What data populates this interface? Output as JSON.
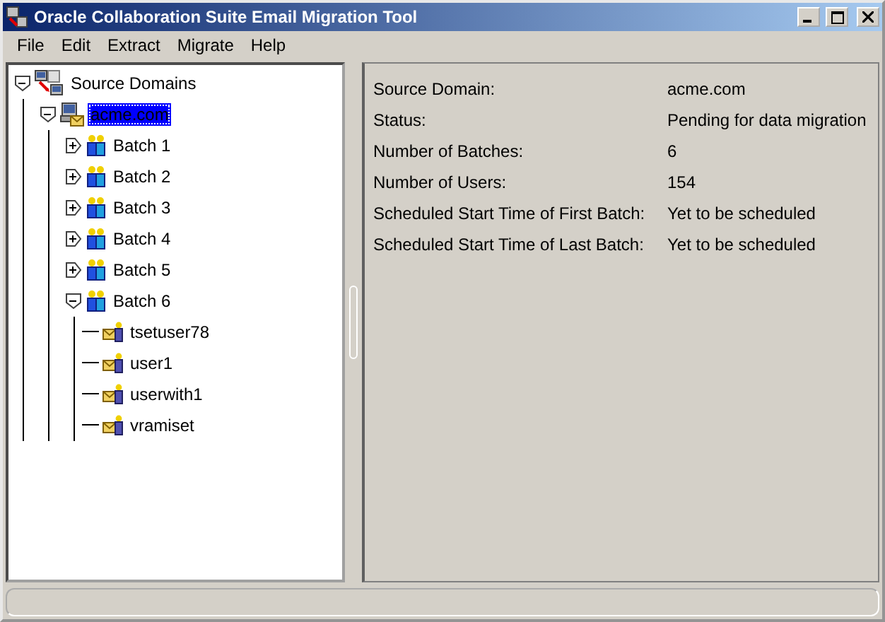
{
  "window": {
    "title": "Oracle Collaboration Suite Email Migration Tool"
  },
  "menu": [
    "File",
    "Edit",
    "Extract",
    "Migrate",
    "Help"
  ],
  "tree": [
    {
      "kind": "root",
      "label": "Source Domains",
      "expanded": true,
      "selected": false,
      "children": [
        {
          "kind": "domain",
          "label": "acme.com",
          "expanded": true,
          "selected": true,
          "children": [
            {
              "kind": "batch",
              "label": "Batch 1",
              "expanded": false,
              "selected": false
            },
            {
              "kind": "batch",
              "label": "Batch 2",
              "expanded": false,
              "selected": false
            },
            {
              "kind": "batch",
              "label": "Batch 3",
              "expanded": false,
              "selected": false
            },
            {
              "kind": "batch",
              "label": "Batch 4",
              "expanded": false,
              "selected": false
            },
            {
              "kind": "batch",
              "label": "Batch 5",
              "expanded": false,
              "selected": false
            },
            {
              "kind": "batch",
              "label": "Batch 6",
              "expanded": true,
              "selected": false,
              "children": [
                {
                  "kind": "user",
                  "label": "tsetuser78",
                  "selected": false
                },
                {
                  "kind": "user",
                  "label": "user1",
                  "selected": false
                },
                {
                  "kind": "user",
                  "label": "userwith1",
                  "selected": false
                },
                {
                  "kind": "user",
                  "label": "vramiset",
                  "selected": false
                }
              ]
            }
          ]
        }
      ]
    }
  ],
  "details": [
    {
      "label": "Source Domain:",
      "value": "acme.com"
    },
    {
      "label": "Status:",
      "value": "Pending for data migration"
    },
    {
      "label": "Number of Batches:",
      "value": "6"
    },
    {
      "label": "Number of Users:",
      "value": "154"
    },
    {
      "label": "Scheduled Start Time of First Batch:",
      "value": "Yet to be scheduled"
    },
    {
      "label": "Scheduled Start Time of Last Batch:",
      "value": "Yet to be scheduled"
    }
  ]
}
